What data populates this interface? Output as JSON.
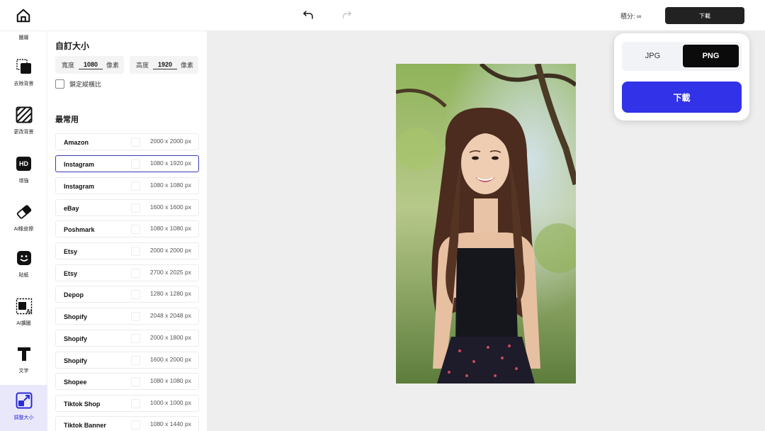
{
  "topbar": {
    "credits_label": "積分: ∞",
    "download_label": "下載"
  },
  "tools": [
    {
      "label": "圖層",
      "icon": "layers-icon"
    },
    {
      "label": "去除背景",
      "icon": "remove-bg-icon"
    },
    {
      "label": "更改背景",
      "icon": "change-bg-icon"
    },
    {
      "label": "HD",
      "sublabel": "增強",
      "icon": "hd-icon"
    },
    {
      "label": "AI橡皮擦",
      "icon": "eraser-icon"
    },
    {
      "label": "貼紙",
      "icon": "sticker-icon"
    },
    {
      "label": "AI擴圖",
      "icon": "ai-expand-icon"
    },
    {
      "label": "文字",
      "icon": "text-icon"
    },
    {
      "label": "調整大小",
      "icon": "resize-icon"
    }
  ],
  "panel": {
    "title": "自訂大小",
    "width_label": "寬度",
    "width_value": "1080",
    "height_label": "高度",
    "height_value": "1920",
    "unit": "像素",
    "lock_label": "鎖定縱橫比",
    "common_title": "最常用",
    "presets": [
      {
        "name": "Amazon",
        "size": "2000 x 2000 px"
      },
      {
        "name": "Instagram",
        "size": "1080 x 1920 px"
      },
      {
        "name": "Instagram",
        "size": "1080 x 1080 px"
      },
      {
        "name": "eBay",
        "size": "1600 x 1600 px"
      },
      {
        "name": "Poshmark",
        "size": "1080 x 1080 px"
      },
      {
        "name": "Etsy",
        "size": "2000 x 2000 px"
      },
      {
        "name": "Etsy",
        "size": "2700 x 2025 px"
      },
      {
        "name": "Depop",
        "size": "1280 x 1280 px"
      },
      {
        "name": "Shopify",
        "size": "2048 x 2048 px"
      },
      {
        "name": "Shopify",
        "size": "2000 x 1800 px"
      },
      {
        "name": "Shopify",
        "size": "1600 x 2000 px"
      },
      {
        "name": "Shopee",
        "size": "1080 x 1080 px"
      },
      {
        "name": "Tiktok Shop",
        "size": "1000 x 1000 px"
      },
      {
        "name": "Tiktok Banner",
        "size": "1080 x 1440 px"
      }
    ]
  },
  "popup": {
    "formats": [
      "JPG",
      "PNG"
    ],
    "selected_format": "PNG",
    "download_label": "下載"
  },
  "colors": {
    "accent": "#3232e8",
    "selected_border": "#3a3ab8",
    "dark_button": "#222222"
  }
}
